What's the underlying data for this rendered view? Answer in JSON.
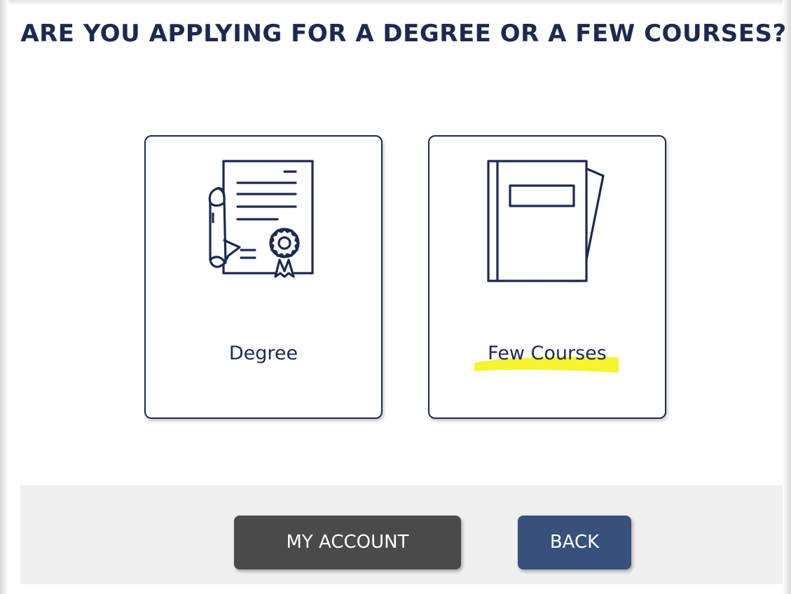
{
  "heading": "ARE YOU APPLYING FOR A DEGREE OR A FEW COURSES?",
  "options": [
    {
      "label": "Degree",
      "icon": "diploma-certificate-icon"
    },
    {
      "label": "Few Courses",
      "icon": "book-icon",
      "highlighted": true
    }
  ],
  "footer": {
    "my_account_label": "MY ACCOUNT",
    "back_label": "BACK"
  },
  "colors": {
    "primary_navy": "#1b2a52",
    "account_button": "#4a4a4a",
    "back_button": "#37517c",
    "footer_background": "#efefef",
    "highlight": "#f6f21a"
  }
}
